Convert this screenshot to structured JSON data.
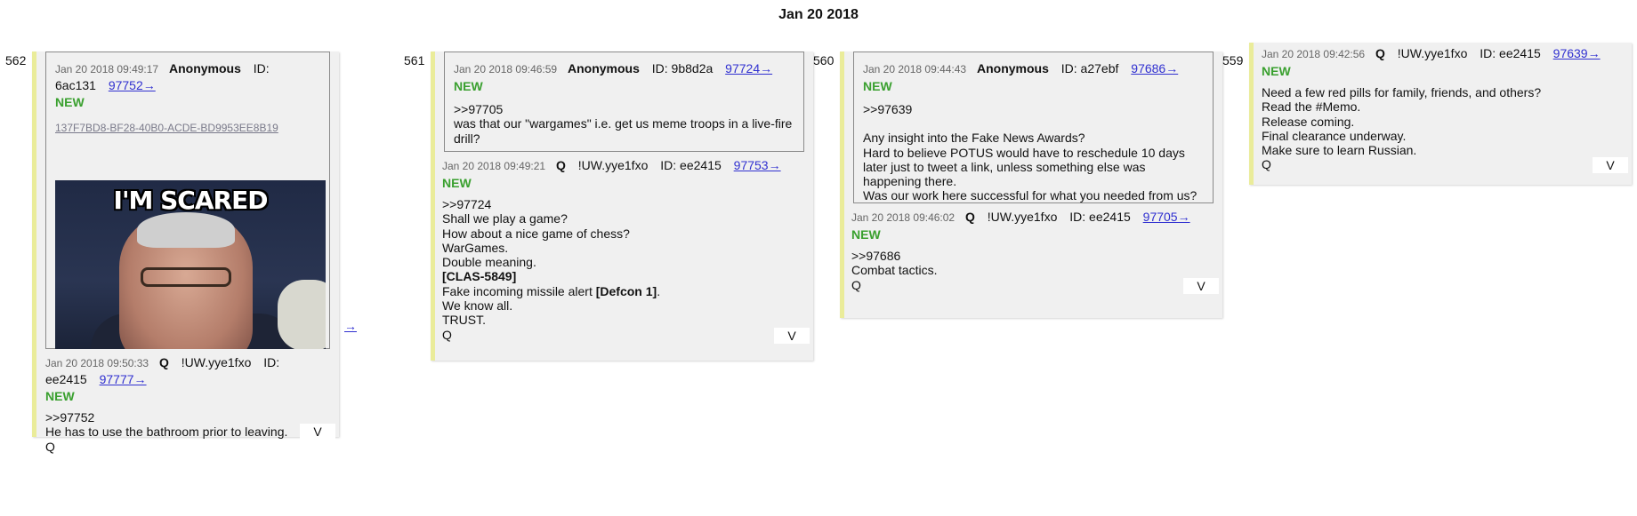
{
  "page": {
    "date_header": "Jan 20 2018"
  },
  "columns": [
    {
      "num": "562",
      "quote": {
        "timestamp": "Jan 20 2018 09:49:17",
        "name": "Anonymous",
        "id": "ID: 6ac131",
        "link": "97752→",
        "new": "NEW",
        "hash": "137F7BD8-BF28-40B0-ACDE-BD9953EE8B19",
        "image_caption": "I'M SCARED",
        "arrow": "→"
      },
      "reply": {
        "timestamp": "Jan 20 2018 09:50:33",
        "q": "Q",
        "trip": "!UW.yye1fxo",
        "id": "ID: ee2415",
        "link": "97777→",
        "new": "NEW",
        "lines": [
          ">>97752",
          "He has to use the bathroom prior to leaving.",
          "Q"
        ],
        "v": "V"
      }
    },
    {
      "num": "561",
      "quote": {
        "timestamp": "Jan 20 2018 09:46:59",
        "name": "Anonymous",
        "id": "ID: 9b8d2a",
        "link": "97724→",
        "new": "NEW",
        "lines": [
          ">>97705",
          "was that our \"wargames\" i.e. get us meme troops in a live-fire drill?"
        ]
      },
      "reply": {
        "timestamp": "Jan 20 2018 09:49:21",
        "q": "Q",
        "trip": "!UW.yye1fxo",
        "id": "ID: ee2415",
        "link": "97753→",
        "new": "NEW",
        "lines": [
          ">>97724",
          "Shall we play a game?",
          "How about a nice game of chess?",
          "WarGames.",
          "Double meaning.",
          "[CLAS-5849]",
          "Fake incoming missile alert ",
          "[Defcon 1]",
          ".",
          "We know all.",
          "TRUST.",
          "Q"
        ],
        "v": "V"
      }
    },
    {
      "num": "560",
      "quote": {
        "timestamp": "Jan 20 2018 09:44:43",
        "name": "Anonymous",
        "id": "ID: a27ebf",
        "link": "97686→",
        "new": "NEW",
        "lines": [
          ">>97639",
          "",
          "Any insight into the Fake News Awards?",
          "Hard to believe POTUS would have to reschedule 10 days later just to tweet a link, unless something else was happening there.",
          "Was our work here successful for what you needed from us?"
        ]
      },
      "reply": {
        "timestamp": "Jan 20 2018 09:46:02",
        "q": "Q",
        "trip": "!UW.yye1fxo",
        "id": "ID: ee2415",
        "link": "97705→",
        "new": "NEW",
        "lines": [
          ">>97686",
          "Combat tactics.",
          "Q"
        ],
        "v": "V"
      }
    },
    {
      "num": "559",
      "reply": {
        "timestamp": "Jan 20 2018 09:42:56",
        "q": "Q",
        "trip": "!UW.yye1fxo",
        "id": "ID: ee2415",
        "link": "97639→",
        "new": "NEW",
        "lines": [
          "Need a few red pills for family, friends, and others?",
          "Read the #Memo.",
          "Release coming.",
          "Final clearance underway.",
          "Make sure to learn Russian.",
          "Q"
        ],
        "v": "V"
      }
    }
  ]
}
